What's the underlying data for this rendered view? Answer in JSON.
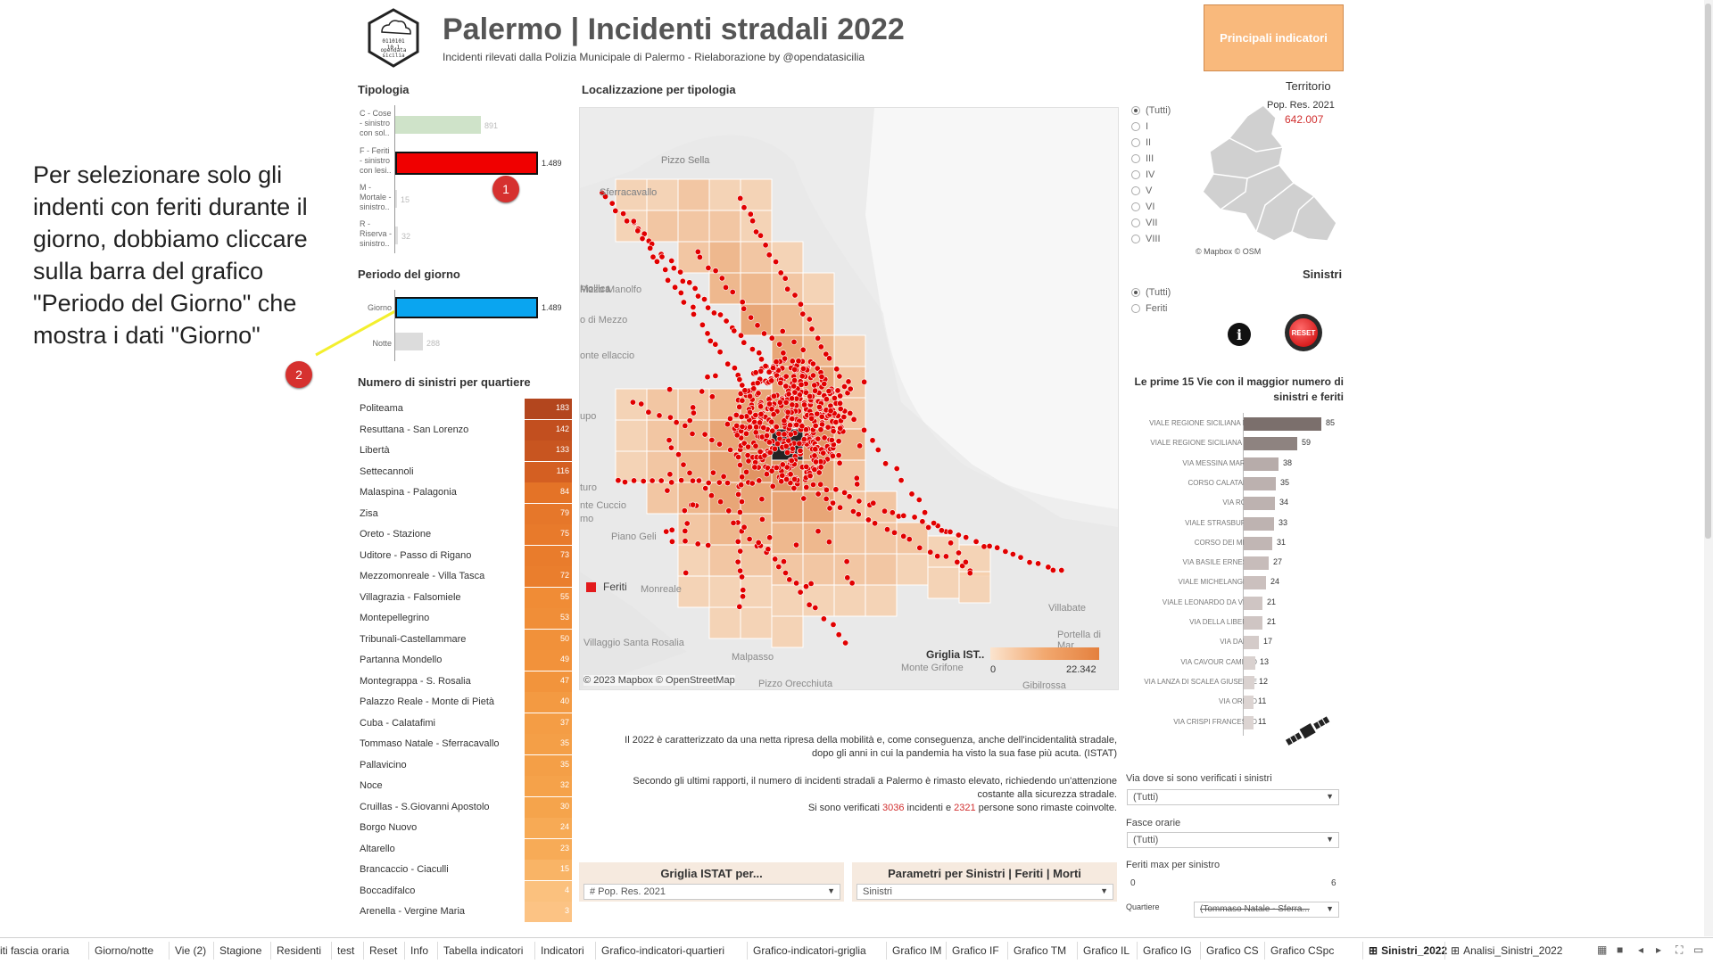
{
  "header": {
    "title": "Palermo | Incidenti stradali 2022",
    "subtitle": "Incidenti rilevati dalla Polizia Municipale di Palermo - Rielaborazione by @opendatasicilia",
    "logo_text": "opendata sicilia",
    "indicators_button": "Principali indicatori"
  },
  "annotation": {
    "text": "Per selezionare solo gli indenti con feriti durante il giorno, dobbiamo cliccare sulla barra del grafico \"Periodo del Giorno\" che mostra i dati \"Giorno\"",
    "badge1": "1",
    "badge2": "2"
  },
  "tipologia": {
    "title": "Tipologia",
    "items": [
      {
        "label": "C - Cose - sinistro con sol..",
        "value": 891,
        "display": "891",
        "color": "#cfe3c9",
        "selected": false
      },
      {
        "label": "F - Feriti - sinistro con lesi..",
        "value": 1489,
        "display": "1.489",
        "color": "#f00000",
        "selected": true
      },
      {
        "label": "M - Mortale - sinistro..",
        "value": 15,
        "display": "15",
        "color": "#e0e0e0",
        "selected": false
      },
      {
        "label": "R - Riserva - sinistro..",
        "value": 32,
        "display": "32",
        "color": "#e0e0e0",
        "selected": false
      }
    ]
  },
  "periodo": {
    "title": "Periodo del giorno",
    "items": [
      {
        "label": "Giorno",
        "value": 1489,
        "display": "1.489",
        "color": "#0aa5f0",
        "selected": true
      },
      {
        "label": "Notte",
        "value": 288,
        "display": "288",
        "color": "#dcdcdc",
        "selected": false
      }
    ]
  },
  "quartieri": {
    "title": "Numero di sinistri per quartiere",
    "items": [
      {
        "name": "Politeama",
        "value": "183",
        "color": "#b3461e"
      },
      {
        "name": "Resuttana - San Lorenzo",
        "value": "142",
        "color": "#c24f1f"
      },
      {
        "name": "Libertà",
        "value": "133",
        "color": "#c85520"
      },
      {
        "name": "Settecannoli",
        "value": "116",
        "color": "#d45f22"
      },
      {
        "name": "Malaspina - Palagonia",
        "value": "84",
        "color": "#e47327"
      },
      {
        "name": "Zisa",
        "value": "79",
        "color": "#e6772a"
      },
      {
        "name": "Oreto - Stazione",
        "value": "75",
        "color": "#e87a2b"
      },
      {
        "name": "Uditore - Passo di Rigano",
        "value": "73",
        "color": "#e97c2c"
      },
      {
        "name": "Mezzomonreale - Villa Tasca",
        "value": "72",
        "color": "#ea7e2d"
      },
      {
        "name": "Villagrazia - Falsomiele",
        "value": "55",
        "color": "#f08c36"
      },
      {
        "name": "Montepellegrino",
        "value": "53",
        "color": "#f08e38"
      },
      {
        "name": "Tribunali-Castellammare",
        "value": "50",
        "color": "#f1913a"
      },
      {
        "name": "Partanna Mondello",
        "value": "49",
        "color": "#f2923b"
      },
      {
        "name": "Montegrappa - S. Rosalia",
        "value": "47",
        "color": "#f2943c"
      },
      {
        "name": "Palazzo Reale - Monte di Pietà",
        "value": "40",
        "color": "#f39a42"
      },
      {
        "name": "Cuba - Calatafimi",
        "value": "37",
        "color": "#f49d45"
      },
      {
        "name": "Tommaso Natale - Sferracavallo",
        "value": "35",
        "color": "#f49f47"
      },
      {
        "name": "Pallavicino",
        "value": "35",
        "color": "#f49f47"
      },
      {
        "name": "Noce",
        "value": "32",
        "color": "#f5a24a"
      },
      {
        "name": "Cruillas - S.Giovanni Apostolo",
        "value": "30",
        "color": "#f5a44c"
      },
      {
        "name": "Borgo Nuovo",
        "value": "24",
        "color": "#f7aa55"
      },
      {
        "name": "Altarello",
        "value": "23",
        "color": "#f7ab57"
      },
      {
        "name": "Brancaccio - Ciaculli",
        "value": "15",
        "color": "#f9b466"
      },
      {
        "name": "Boccadifalco",
        "value": "4",
        "color": "#fbc17e"
      },
      {
        "name": "Arenella - Vergine Maria",
        "value": "3",
        "color": "#fcc384"
      }
    ]
  },
  "map": {
    "title": "Localizzazione per tipologia",
    "places": [
      "Pizzo Sella",
      "Sferracavallo",
      "Pizzo Manolfo",
      "Mollica",
      "o di Mezzo",
      "onte ellaccio",
      "upo",
      "turo",
      "nte Cuccio",
      "mo",
      "Piano Geli",
      "Monreale",
      "Villaggio Santa Rosalia",
      "Malpasso",
      "Pizzo Orecchiuta",
      "Villabate",
      "Portella di Mar",
      "Monte Grifone",
      "Gibilrossa"
    ],
    "legend_label": "Feriti",
    "legend_color": "#e31a1c",
    "grid_legend_title": "Griglia IST..",
    "grid_min": "0",
    "grid_max": "22.342",
    "attribution": "© 2023 Mapbox © OpenStreetMap"
  },
  "territorio": {
    "title": "Territorio",
    "pop_label": "Pop. Res. 2021",
    "pop_value": "642.007",
    "options": [
      "(Tutti)",
      "I",
      "II",
      "III",
      "IV",
      "V",
      "VI",
      "VII",
      "VIII"
    ],
    "selected": "(Tutti)",
    "map_attribution": "© Mapbox © OSM"
  },
  "sinistri": {
    "title": "Sinistri",
    "options": [
      "(Tutti)",
      "Feriti"
    ],
    "selected": "(Tutti)",
    "info_icon": "i",
    "reset_label": "RESET"
  },
  "vie": {
    "title": "Le prime 15 Vie con il maggior numero di sinistri e feriti",
    "items": [
      {
        "name": "VIALE REGIONE SICILIANA N.O.",
        "value": 85,
        "color": "#7b6f6c"
      },
      {
        "name": "VIALE REGIONE SICILIANA S.E.",
        "value": 59,
        "color": "#8e8380"
      },
      {
        "name": "VIA MESSINA MARINE",
        "value": 38,
        "color": "#b7acaa"
      },
      {
        "name": "CORSO CALATAFIMI",
        "value": 35,
        "color": "#bcb1af"
      },
      {
        "name": "VIA ROMA",
        "value": 34,
        "color": "#bdb2b0"
      },
      {
        "name": "VIALE STRASBURGO",
        "value": 33,
        "color": "#beb3b1"
      },
      {
        "name": "CORSO DEI MILLE",
        "value": 31,
        "color": "#c1b6b4"
      },
      {
        "name": "VIA BASILE ERNESTO",
        "value": 27,
        "color": "#c7bcba"
      },
      {
        "name": "VIALE MICHELANGELO",
        "value": 24,
        "color": "#cbc0be"
      },
      {
        "name": "VIALE LEONARDO DA VINCI",
        "value": 21,
        "color": "#cfc5c3"
      },
      {
        "name": "VIA DELLA LIBERTA'",
        "value": 21,
        "color": "#cfc5c3"
      },
      {
        "name": "VIA DANTE",
        "value": 17,
        "color": "#d4cbc9"
      },
      {
        "name": "VIA CAVOUR CAMILLO",
        "value": 13,
        "color": "#d9d1cf"
      },
      {
        "name": "VIA LANZA DI SCALEA GIUSEPPE",
        "value": 12,
        "color": "#dad2d0"
      },
      {
        "name": "VIA ORETO",
        "value": 11,
        "color": "#dcd4d2"
      },
      {
        "name": "VIA CRISPI FRANCESCO",
        "value": 11,
        "color": "#dcd4d2"
      }
    ]
  },
  "description": {
    "p1a": "Il 2022 è caratterizzato da una netta ripresa della mobilità e, come conseguenza, anche dell'incidentalità stradale,",
    "p1b": "dopo gli anni in cui la pandemia ha visto la sua fase più acuta. (ISTAT)",
    "p2a": "Secondo gli ultimi rapporti, il numero di incidenti stradali a Palermo è rimasto elevato, richiedendo un'attenzione",
    "p2b": "costante alla sicurezza stradale.",
    "p3_pre": "Si sono verificati ",
    "p3_n1": "3036",
    "p3_mid": " incidenti e ",
    "p3_n2": "2321",
    "p3_post": " persone sono rimaste coinvolte."
  },
  "controls": {
    "griglia_title": "Griglia ISTAT per...",
    "griglia_value": "# Pop. Res. 2021",
    "parametri_title": "Parametri per Sinistri | Feriti | Morti",
    "parametri_value": "Sinistri",
    "via_label": "Via dove si sono verificati i sinistri",
    "via_value": "(Tutti)",
    "fasce_label": "Fasce orarie",
    "fasce_value": "(Tutti)",
    "feriti_label": "Feriti max per sinistro",
    "feriti_min": "0",
    "feriti_max": "6",
    "quartiere_label": "Quartiere",
    "quartiere_value": "(Tommaso Natale - Sferra..."
  },
  "tabs": [
    "iti fascia oraria",
    "Giorno/notte",
    "Vie (2)",
    "Stagione",
    "Residenti",
    "test",
    "Reset",
    "Info",
    "Tabella indicatori",
    "Indicatori",
    "Grafico-indicatori-quartieri",
    "Grafico-indicatori-griglia",
    "Grafico IM",
    "Grafico IF",
    "Grafico TM",
    "Grafico IL",
    "Grafico IG",
    "Grafico CS",
    "Grafico CSpc",
    "Sinistri_2022",
    "Analisi_Sinistri_2022"
  ],
  "active_tab": "Sinistri_2022"
}
